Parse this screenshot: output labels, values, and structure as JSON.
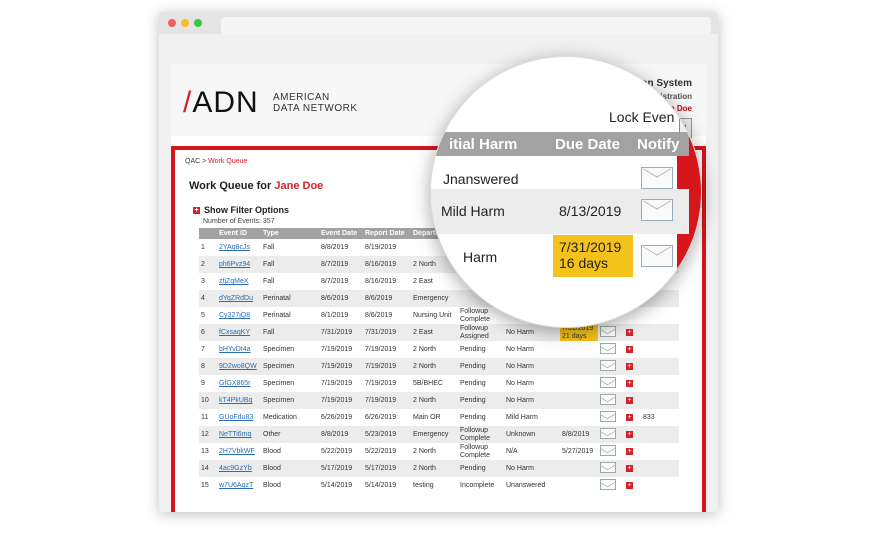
{
  "header": {
    "logo_mark": "ADN",
    "logo_line1": "AMERICAN",
    "logo_line2": "DATA NETWORK",
    "system_title": "Quality ... unication System",
    "admin_label": "Administration",
    "user_label": "Jane Doe"
  },
  "breadcrumb": {
    "root": "QAC",
    "sep": ">",
    "current": "Work Queue"
  },
  "work_queue": {
    "title_prefix": "Work Queue for",
    "user": "Jane Doe",
    "filter_label": "Show Filter Options",
    "count_label": "Number of Events: 357"
  },
  "table": {
    "columns": [
      "",
      "Event ID",
      "Type",
      "Event Date",
      "Report Date",
      "Departm",
      "",
      "",
      "",
      "",
      ""
    ],
    "rows": [
      {
        "n": "1",
        "id": "2YAq8cJs",
        "type": "Fall",
        "event": "8/8/2019",
        "report": "8/19/2019",
        "dept": "",
        "status": "",
        "harm": "",
        "due": "",
        "hl": false,
        "notify": "",
        "extra": ""
      },
      {
        "n": "2",
        "id": "ph6Pvz94",
        "type": "Fall",
        "event": "8/7/2019",
        "report": "8/16/2019",
        "dept": "2 North",
        "status": "",
        "harm": "",
        "due": "",
        "hl": false,
        "notify": "",
        "extra": ""
      },
      {
        "n": "3",
        "id": "ztjZqMeX",
        "type": "Fall",
        "event": "8/7/2019",
        "report": "8/16/2019",
        "dept": "2 East",
        "status": "",
        "harm": "",
        "due": "",
        "hl": false,
        "notify": "",
        "extra": ""
      },
      {
        "n": "4",
        "id": "dYqZRdDu",
        "type": "Perinatal",
        "event": "8/6/2019",
        "report": "8/6/2019",
        "dept": "Emergency",
        "status": "",
        "harm": "",
        "due": "",
        "hl": false,
        "notify": "",
        "extra": ""
      },
      {
        "n": "5",
        "id": "Cy327jQ8",
        "type": "Perinatal",
        "event": "8/1/2019",
        "report": "8/6/2019",
        "dept": "Nursing Unit",
        "status": "Followup Complete",
        "harm": "",
        "due": "",
        "hl": false,
        "notify": "",
        "extra": ""
      },
      {
        "n": "6",
        "id": "fCxsaqKY",
        "type": "Fall",
        "event": "7/31/2019",
        "report": "7/31/2019",
        "dept": "2 East",
        "status": "Followup Assigned",
        "harm": "No Harm",
        "due": "7/31/2019\n21 days",
        "hl": true,
        "notify": "env",
        "extra": ""
      },
      {
        "n": "7",
        "id": "bHYvDt4a",
        "type": "Specimen",
        "event": "7/19/2019",
        "report": "7/19/2019",
        "dept": "2 North",
        "status": "Pending",
        "harm": "No Harm",
        "due": "",
        "hl": false,
        "notify": "env",
        "extra": ""
      },
      {
        "n": "8",
        "id": "9D2wo8QW",
        "type": "Specimen",
        "event": "7/19/2019",
        "report": "7/19/2019",
        "dept": "2 North",
        "status": "Pending",
        "harm": "No Harm",
        "due": "",
        "hl": false,
        "notify": "env",
        "extra": ""
      },
      {
        "n": "9",
        "id": "GfGX865r",
        "type": "Specimen",
        "event": "7/19/2019",
        "report": "7/19/2019",
        "dept": "5B/BHEC",
        "status": "Pending",
        "harm": "No Harm",
        "due": "",
        "hl": false,
        "notify": "env",
        "extra": ""
      },
      {
        "n": "10",
        "id": "kT4PkUBq",
        "type": "Specimen",
        "event": "7/19/2019",
        "report": "7/19/2019",
        "dept": "2 North",
        "status": "Pending",
        "harm": "No Harm",
        "due": "",
        "hl": false,
        "notify": "env",
        "extra": ""
      },
      {
        "n": "11",
        "id": "GUoFdu83",
        "type": "Medication",
        "event": "6/26/2019",
        "report": "6/26/2019",
        "dept": "Main OR",
        "status": "Pending",
        "harm": "Mild Harm",
        "due": "",
        "hl": false,
        "notify": "env",
        "extra": "833"
      },
      {
        "n": "12",
        "id": "NeTTi6mq",
        "type": "Other",
        "event": "8/8/2019",
        "report": "5/23/2019",
        "dept": "Emergency",
        "status": "Followup Complete",
        "harm": "Unknown",
        "due": "8/8/2019",
        "hl": false,
        "notify": "env",
        "extra": ""
      },
      {
        "n": "13",
        "id": "2H7VbkWF",
        "type": "Blood",
        "event": "5/22/2019",
        "report": "5/22/2019",
        "dept": "2 North",
        "status": "Followup Complete",
        "harm": "N/A",
        "due": "5/27/2019",
        "hl": false,
        "notify": "env",
        "extra": ""
      },
      {
        "n": "14",
        "id": "4ac9GzYb",
        "type": "Blood",
        "event": "5/17/2019",
        "report": "5/17/2019",
        "dept": "2 North",
        "status": "Pending",
        "harm": "No Harm",
        "due": "",
        "hl": false,
        "notify": "env",
        "extra": ""
      },
      {
        "n": "15",
        "id": "w7U6AqzT",
        "type": "Blood",
        "event": "5/14/2019",
        "report": "5/14/2019",
        "dept": "testing",
        "status": "Incomplete",
        "harm": "Unanswered",
        "due": "",
        "hl": false,
        "notify": "env",
        "extra": ""
      }
    ]
  },
  "magnifier": {
    "lock_label": "Lock Even",
    "col_harm": "itial Harm",
    "col_due": "Due Date",
    "col_notify": "Notify",
    "rows": [
      {
        "harm": "Jnanswered",
        "due": "",
        "due2": "",
        "hl": false
      },
      {
        "harm": "Mild Harm",
        "due": "8/13/2019",
        "due2": "",
        "hl": false
      },
      {
        "harm": "Harm",
        "due": "7/31/2019",
        "due2": "16 days",
        "hl": true
      }
    ]
  },
  "colors": {
    "brand_red": "#d7161c",
    "highlight": "#f5c21b",
    "header_gray": "#a2a2a2",
    "link": "#2a6db5"
  }
}
